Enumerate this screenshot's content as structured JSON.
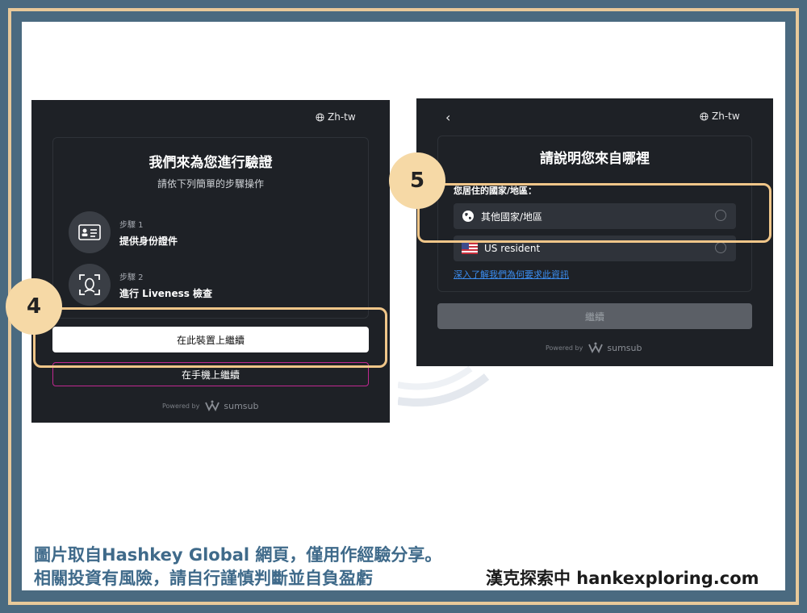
{
  "left_panel": {
    "language": "Zh-tw",
    "title": "我們來為您進行驗證",
    "subtitle": "請依下列簡單的步驟操作",
    "steps": [
      {
        "label": "步驟 1",
        "text": "提供身份證件"
      },
      {
        "label": "步驟 2",
        "text": "進行 Liveness 檢查"
      }
    ],
    "primary_button": "在此裝置上繼續",
    "secondary_button": "在手機上繼續",
    "powered_by": "Powered by",
    "brand": "sumsub"
  },
  "right_panel": {
    "language": "Zh-tw",
    "title": "請說明您來自哪裡",
    "field_label": "您居住的國家/地區：",
    "options": [
      {
        "text": "其他國家/地區",
        "icon": "globe-icon"
      },
      {
        "text": "US resident",
        "icon": "us-flag-icon"
      }
    ],
    "info_link": "深入了解我們為何要求此資訊",
    "continue_button": "繼續",
    "powered_by": "Powered by",
    "brand": "sumsub"
  },
  "annotations": {
    "badge_4": "4",
    "badge_5": "5",
    "highlight_color": "#f0c689",
    "badge_color": "#f6d9a6"
  },
  "footer": {
    "line1": "圖片取自Hashkey Global 網頁，僅用作經驗分享。",
    "line2": "相關投資有風險，請自行謹慎判斷並自負盈虧",
    "brand": "漢克探索中 hankexploring.com"
  },
  "colors": {
    "frame": "#4a6a80",
    "frame_border": "#e8c99a",
    "panel_bg": "#1e2126",
    "link": "#3b8ef2",
    "footer_text": "#3f6a8a"
  }
}
